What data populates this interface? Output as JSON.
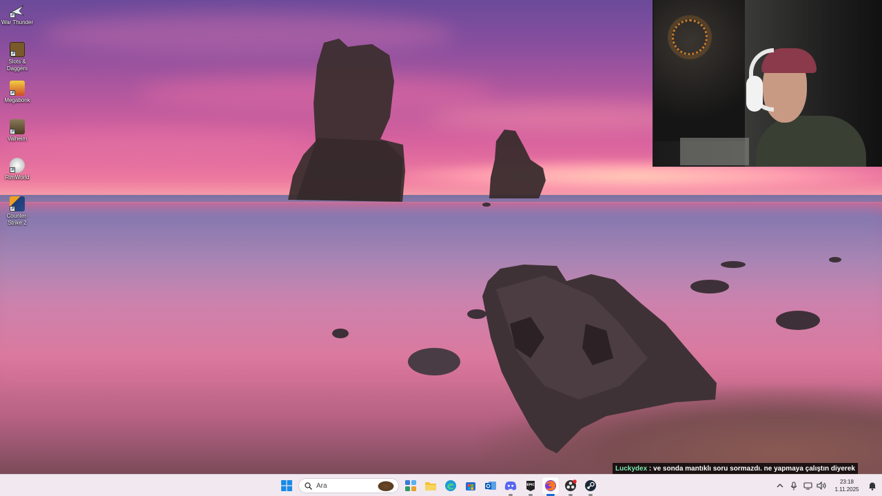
{
  "desktop": {
    "icons": [
      {
        "label": "War Thunder",
        "icon": "war-thunder-icon",
        "color": "#e8eef6"
      },
      {
        "label": "Slots & Daggers",
        "icon": "slots-and-daggers-icon",
        "color": "#7a5a2a"
      },
      {
        "label": "Megabonk",
        "icon": "megabonk-icon",
        "color": "#d04a2a"
      },
      {
        "label": "Valheim",
        "icon": "valheim-icon",
        "color": "#6b5a3a"
      },
      {
        "label": "RimWorld",
        "icon": "rimworld-icon",
        "color": "#d9d9d9"
      },
      {
        "label": "Counter-Strike 2",
        "icon": "counter-strike-2-icon",
        "color": "#2a4a8a"
      }
    ]
  },
  "chat": {
    "username": "Luckydex",
    "separator": " : ",
    "message": "ve sonda mantıklı soru sormazdı. ne yapmaya çalıştın diyerek",
    "username_color": "#7ee8b0"
  },
  "taskbar": {
    "search_placeholder": "Ara",
    "apps": [
      {
        "icon": "start-icon"
      },
      {
        "icon": "widgets-icon"
      },
      {
        "icon": "file-explorer-icon"
      },
      {
        "icon": "edge-icon"
      },
      {
        "icon": "microsoft-store-icon"
      },
      {
        "icon": "outlook-icon"
      },
      {
        "icon": "discord-icon"
      },
      {
        "icon": "epic-games-icon"
      },
      {
        "icon": "firefox-icon"
      },
      {
        "icon": "obs-icon"
      },
      {
        "icon": "steam-icon"
      }
    ],
    "clock_time": "23:18",
    "clock_date": "1.11.2025"
  }
}
